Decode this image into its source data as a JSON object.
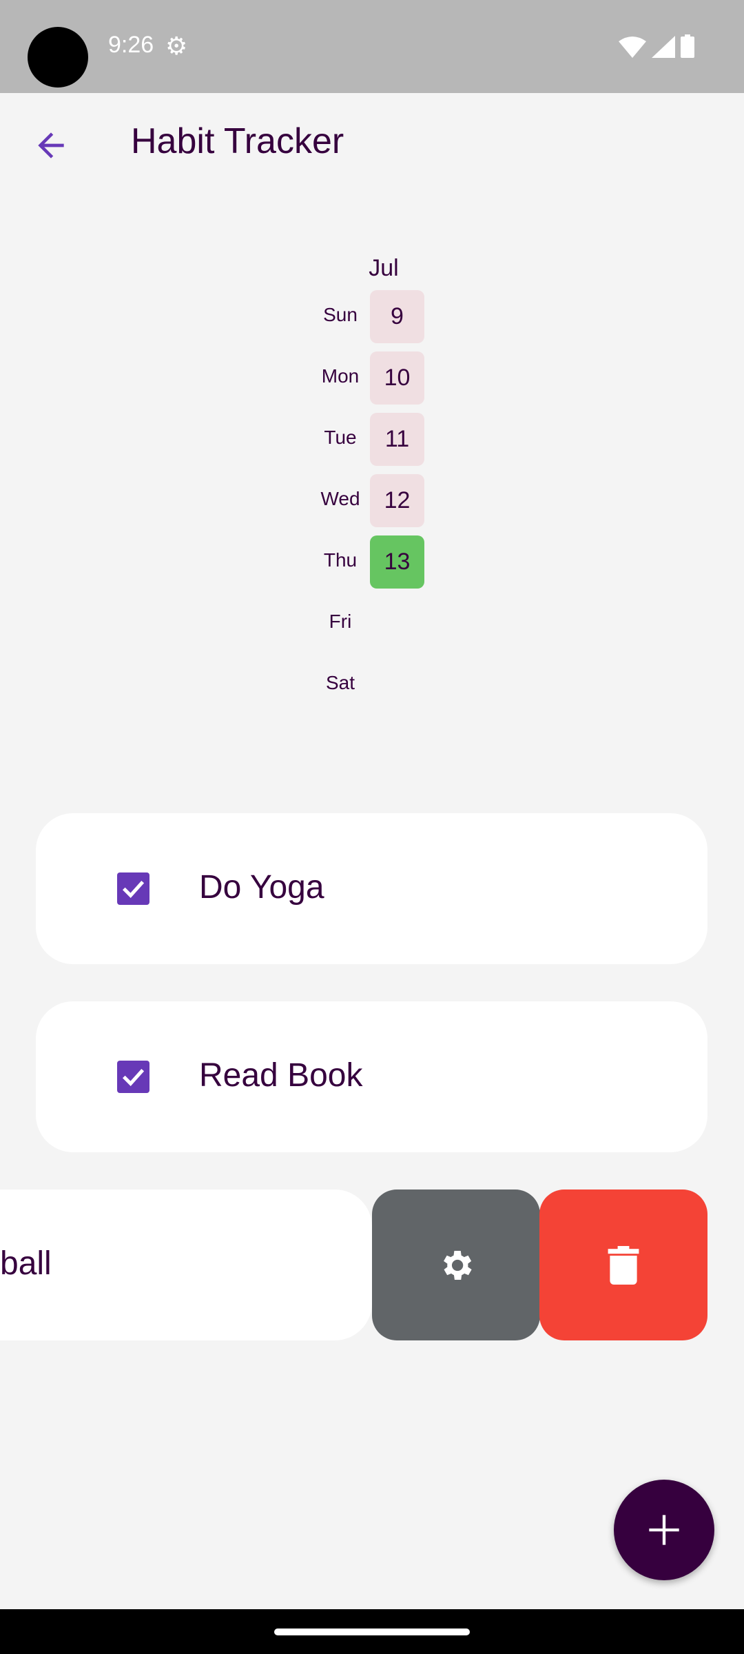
{
  "status_bar": {
    "time": "9:26",
    "icons": [
      "settings-icon",
      "wifi-icon",
      "signal-icon",
      "battery-icon"
    ]
  },
  "app_bar": {
    "title": "Habit Tracker",
    "back_icon": "arrow-back-icon"
  },
  "calendar": {
    "month": "Jul",
    "days": [
      {
        "label": "Sun",
        "date": "9",
        "status": "missed"
      },
      {
        "label": "Mon",
        "date": "10",
        "status": "missed"
      },
      {
        "label": "Tue",
        "date": "11",
        "status": "missed"
      },
      {
        "label": "Wed",
        "date": "12",
        "status": "missed"
      },
      {
        "label": "Thu",
        "date": "13",
        "status": "done"
      },
      {
        "label": "Fri",
        "date": "",
        "status": "none"
      },
      {
        "label": "Sat",
        "date": "",
        "status": "none"
      }
    ]
  },
  "habits": [
    {
      "name": "Do Yoga",
      "checked": true
    },
    {
      "name": "Read Book",
      "checked": true
    },
    {
      "name": "ball",
      "checked": false
    }
  ],
  "swipe_actions": {
    "settings_icon": "settings-icon",
    "delete_icon": "delete-icon"
  },
  "fab": {
    "icon": "add-icon"
  },
  "colors": {
    "accent": "#6739b7",
    "text": "#36003e",
    "done": "#66c561",
    "missed": "#f0dfe2",
    "settings": "#616568",
    "delete": "#f44336"
  }
}
